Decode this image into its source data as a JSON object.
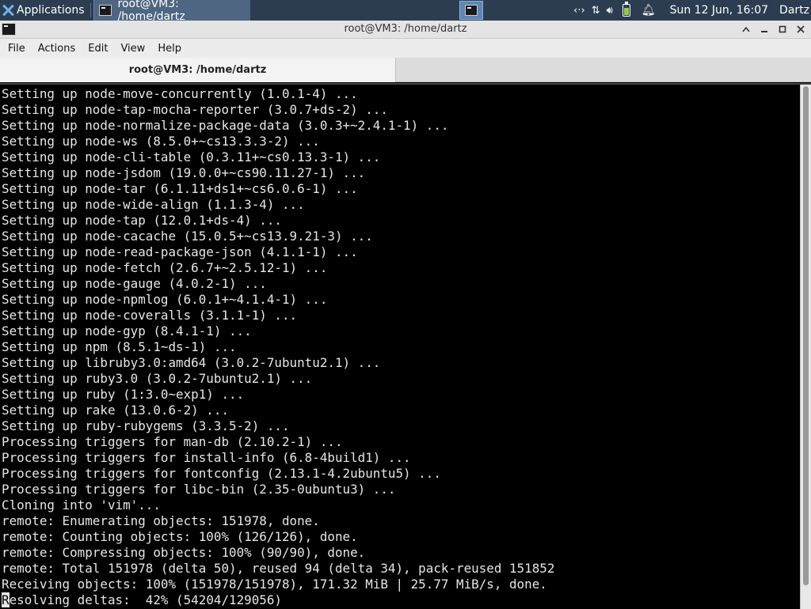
{
  "panel": {
    "apps_label": "Applications",
    "task_label": "root@VM3: /home/dartz",
    "clock": "Sun 12 Jun, 16:07",
    "user": "Dartz",
    "icons": [
      "xfce-logo-icon",
      "terminal-icon",
      "network-icon",
      "updown-arrows-icon",
      "volume-icon",
      "battery-icon",
      "bell-icon"
    ]
  },
  "window": {
    "title": "root@VM3: /home/dartz",
    "controls": [
      "minimize",
      "maximize",
      "close"
    ]
  },
  "menu": [
    "File",
    "Actions",
    "Edit",
    "View",
    "Help"
  ],
  "tab": {
    "label": "root@VM3: /home/dartz"
  },
  "terminal": {
    "lines": [
      "Setting up node-move-concurrently (1.0.1-4) ...",
      "Setting up node-tap-mocha-reporter (3.0.7+ds-2) ...",
      "Setting up node-normalize-package-data (3.0.3+~2.4.1-1) ...",
      "Setting up node-ws (8.5.0+~cs13.3.3-2) ...",
      "Setting up node-cli-table (0.3.11+~cs0.13.3-1) ...",
      "Setting up node-jsdom (19.0.0+~cs90.11.27-1) ...",
      "Setting up node-tar (6.1.11+ds1+~cs6.0.6-1) ...",
      "Setting up node-wide-align (1.1.3-4) ...",
      "Setting up node-tap (12.0.1+ds-4) ...",
      "Setting up node-cacache (15.0.5+~cs13.9.21-3) ...",
      "Setting up node-read-package-json (4.1.1-1) ...",
      "Setting up node-fetch (2.6.7+~2.5.12-1) ...",
      "Setting up node-gauge (4.0.2-1) ...",
      "Setting up node-npmlog (6.0.1+~4.1.4-1) ...",
      "Setting up node-coveralls (3.1.1-1) ...",
      "Setting up node-gyp (8.4.1-1) ...",
      "Setting up npm (8.5.1~ds-1) ...",
      "Setting up libruby3.0:amd64 (3.0.2-7ubuntu2.1) ...",
      "Setting up ruby3.0 (3.0.2-7ubuntu2.1) ...",
      "Setting up ruby (1:3.0~exp1) ...",
      "Setting up rake (13.0.6-2) ...",
      "Setting up ruby-rubygems (3.3.5-2) ...",
      "Processing triggers for man-db (2.10.2-1) ...",
      "Processing triggers for install-info (6.8-4build1) ...",
      "Processing triggers for fontconfig (2.13.1-4.2ubuntu5) ...",
      "Processing triggers for libc-bin (2.35-0ubuntu3) ...",
      "Cloning into 'vim'...",
      "remote: Enumerating objects: 151978, done.",
      "remote: Counting objects: 100% (126/126), done.",
      "remote: Compressing objects: 100% (90/90), done.",
      "remote: Total 151978 (delta 50), reused 94 (delta 34), pack-reused 151852",
      "Receiving objects: 100% (151978/151978), 171.32 MiB | 25.77 MiB/s, done."
    ],
    "last_line_cursor_char": "R",
    "last_line_rest": "esolving deltas:  42% (54204/129056)"
  }
}
